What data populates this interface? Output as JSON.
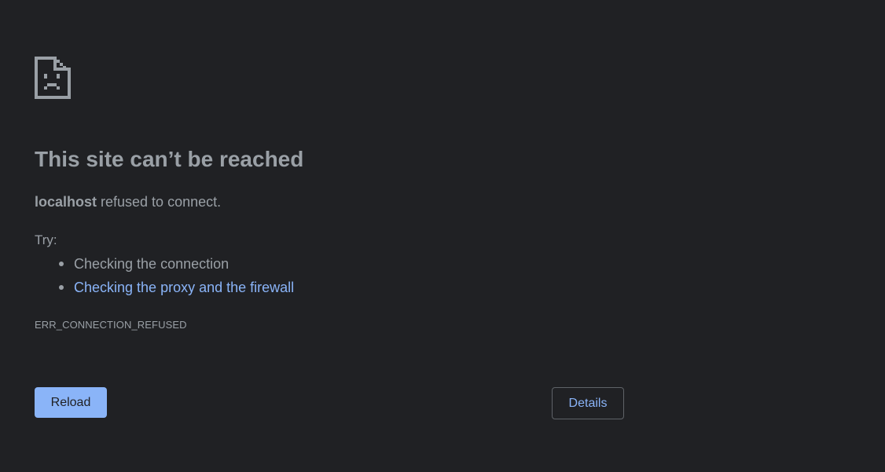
{
  "error_page": {
    "icon": "sad-document-icon",
    "title": "This site can’t be reached",
    "summary": {
      "host": "localhost",
      "message": " refused to connect."
    },
    "try_label": "Try:",
    "suggestions": [
      {
        "text": "Checking the connection",
        "is_link": false
      },
      {
        "text": "Checking the proxy and the firewall",
        "is_link": true
      }
    ],
    "error_code": "ERR_CONNECTION_REFUSED",
    "buttons": {
      "reload_label": "Reload",
      "details_label": "Details"
    }
  },
  "colors": {
    "background": "#202124",
    "text": "#9aa0a6",
    "link": "#8ab4f8",
    "primary_button": "#8ab4f8",
    "button_border": "#5f6368"
  }
}
